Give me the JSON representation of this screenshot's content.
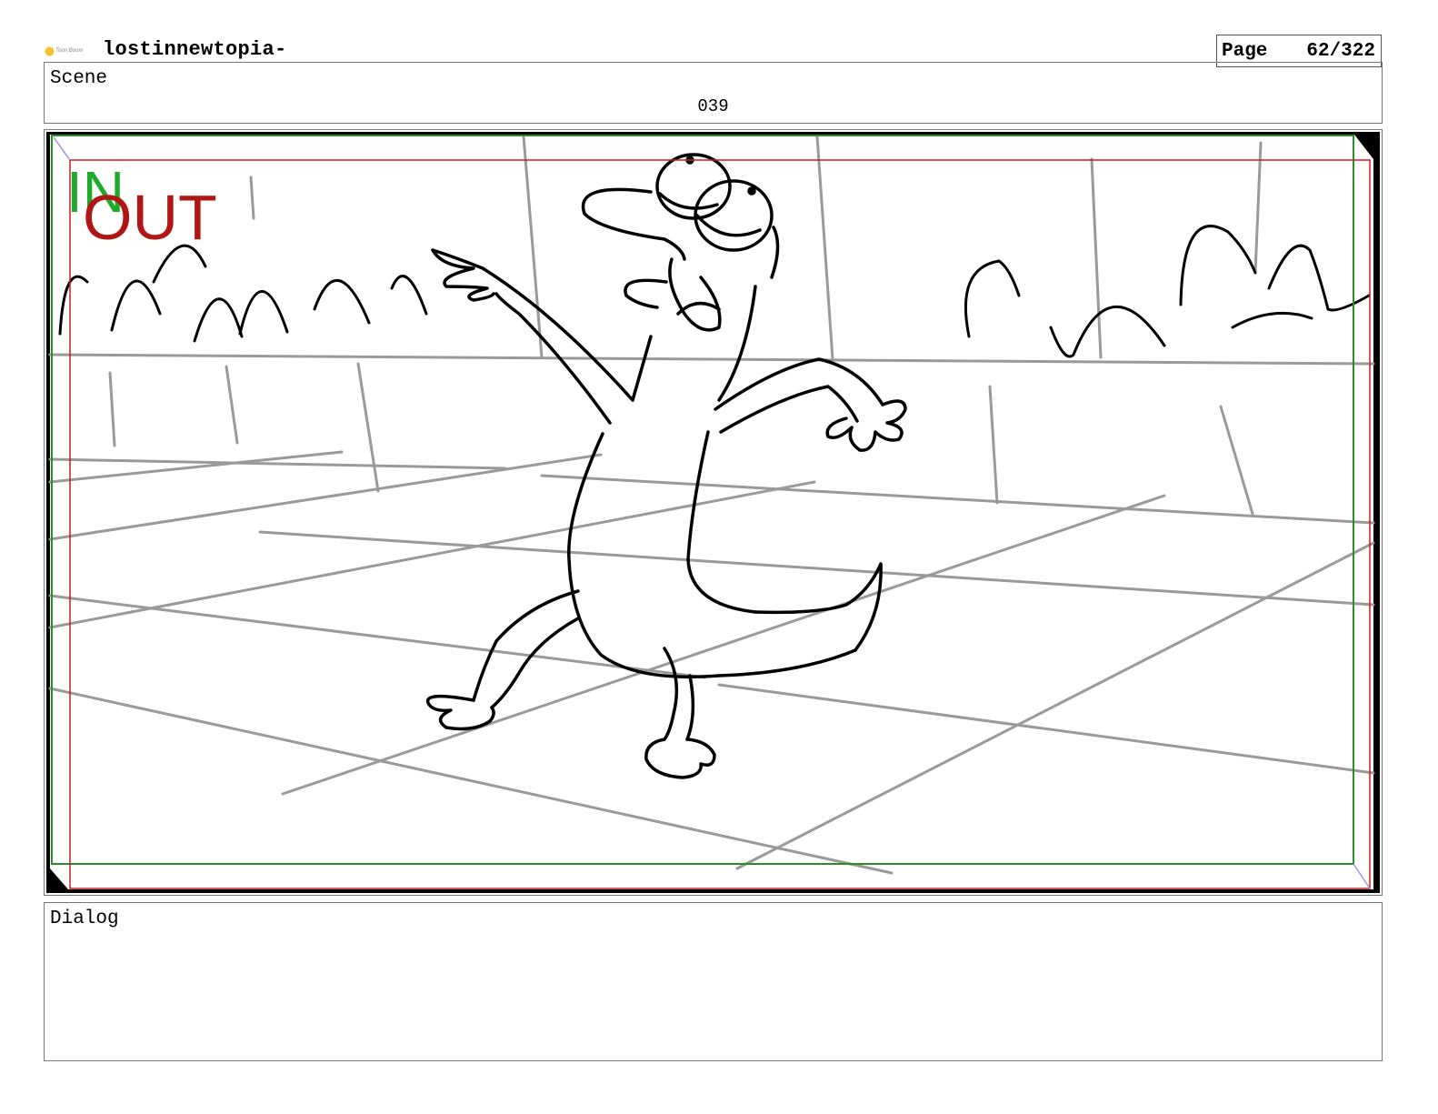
{
  "header": {
    "logo_text": "Toon Boom",
    "project_title": "lostinnewtopia-",
    "page_label": "Page",
    "page_number": "62/322"
  },
  "scene": {
    "label": "Scene",
    "number": "039"
  },
  "panel": {
    "in_marker": "IN",
    "out_marker": "OUT",
    "colors": {
      "in_marker": "#1faa2a",
      "out_marker": "#b01616",
      "safe_frame_green": "#2e8b2e",
      "safe_frame_red": "#c02020",
      "background_lines": "#9a9a9a"
    }
  },
  "dialog": {
    "label": "Dialog",
    "text": ""
  }
}
